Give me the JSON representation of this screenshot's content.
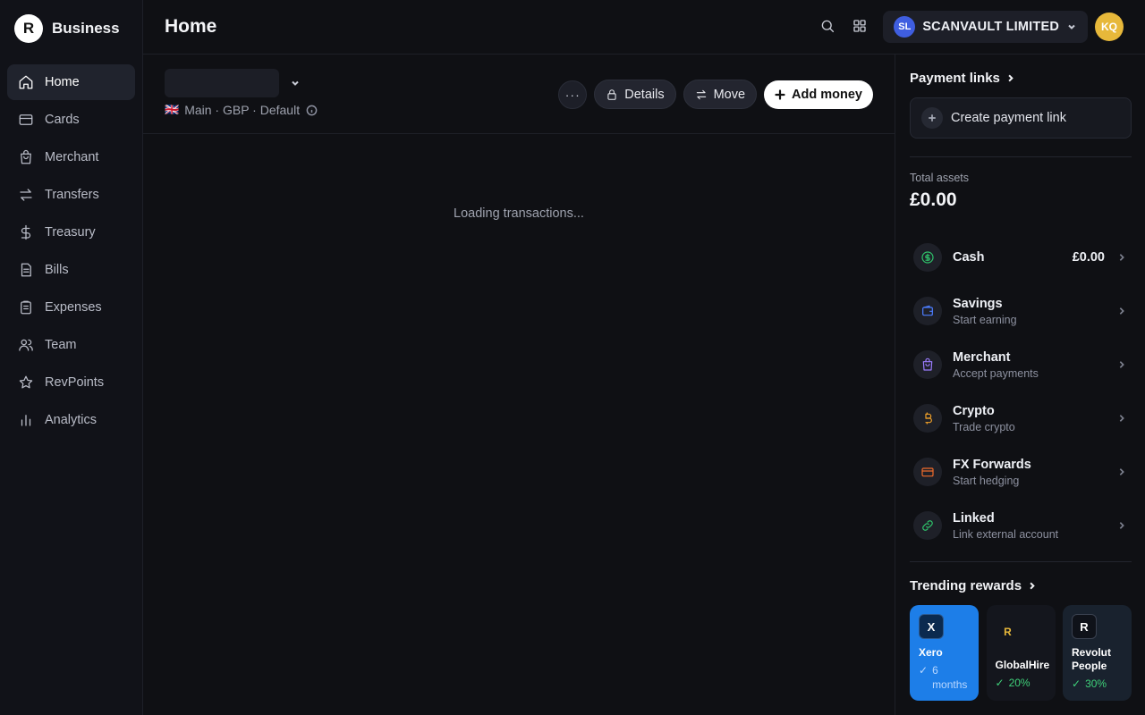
{
  "brand": {
    "logo_letter": "R",
    "name": "Business"
  },
  "sidebar": {
    "items": [
      {
        "label": "Home",
        "icon": "home-icon",
        "active": true
      },
      {
        "label": "Cards",
        "icon": "card-icon"
      },
      {
        "label": "Merchant",
        "icon": "bag-icon"
      },
      {
        "label": "Transfers",
        "icon": "transfer-icon"
      },
      {
        "label": "Treasury",
        "icon": "dollar-icon"
      },
      {
        "label": "Bills",
        "icon": "document-icon"
      },
      {
        "label": "Expenses",
        "icon": "clipboard-icon"
      },
      {
        "label": "Team",
        "icon": "team-icon"
      },
      {
        "label": "RevPoints",
        "icon": "star-icon"
      },
      {
        "label": "Analytics",
        "icon": "bar-chart-icon"
      }
    ]
  },
  "header": {
    "title": "Home",
    "org": {
      "initials": "SL",
      "name": "SCANVAULT LIMITED"
    },
    "user_initials": "KQ"
  },
  "account": {
    "flag": "🇬🇧",
    "meta": "Main · GBP · Default",
    "actions": {
      "more": "···",
      "details": "Details",
      "move": "Move",
      "add_money": "Add money"
    }
  },
  "transactions": {
    "loading_text": "Loading transactions..."
  },
  "right_panel": {
    "payment_links_title": "Payment links",
    "create_payment_link": "Create payment link",
    "total_assets_label": "Total assets",
    "total_assets_value": "£0.00",
    "assets": [
      {
        "name": "Cash",
        "amount": "£0.00",
        "icon": "dollar-circle-icon",
        "color": "#2fc26b"
      },
      {
        "name": "Savings",
        "sub": "Start earning",
        "icon": "wallet-icon",
        "color": "#4c7dff"
      },
      {
        "name": "Merchant",
        "sub": "Accept payments",
        "icon": "bag-icon",
        "color": "#9b7cff"
      },
      {
        "name": "Crypto",
        "sub": "Trade crypto",
        "icon": "crypto-icon",
        "color": "#f0a029"
      },
      {
        "name": "FX Forwards",
        "sub": "Start hedging",
        "icon": "fx-card-icon",
        "color": "#f06b2b"
      },
      {
        "name": "Linked",
        "sub": "Link external account",
        "icon": "link-icon",
        "color": "#2fc26b"
      }
    ],
    "trending_title": "Trending rewards",
    "rewards": [
      {
        "logo": "X",
        "name": "Xero",
        "perk": "6 months"
      },
      {
        "logo": "R",
        "name": "GlobalHire",
        "perk": "20%"
      },
      {
        "logo": "R",
        "name": "Revolut People",
        "perk": "30%"
      }
    ]
  }
}
